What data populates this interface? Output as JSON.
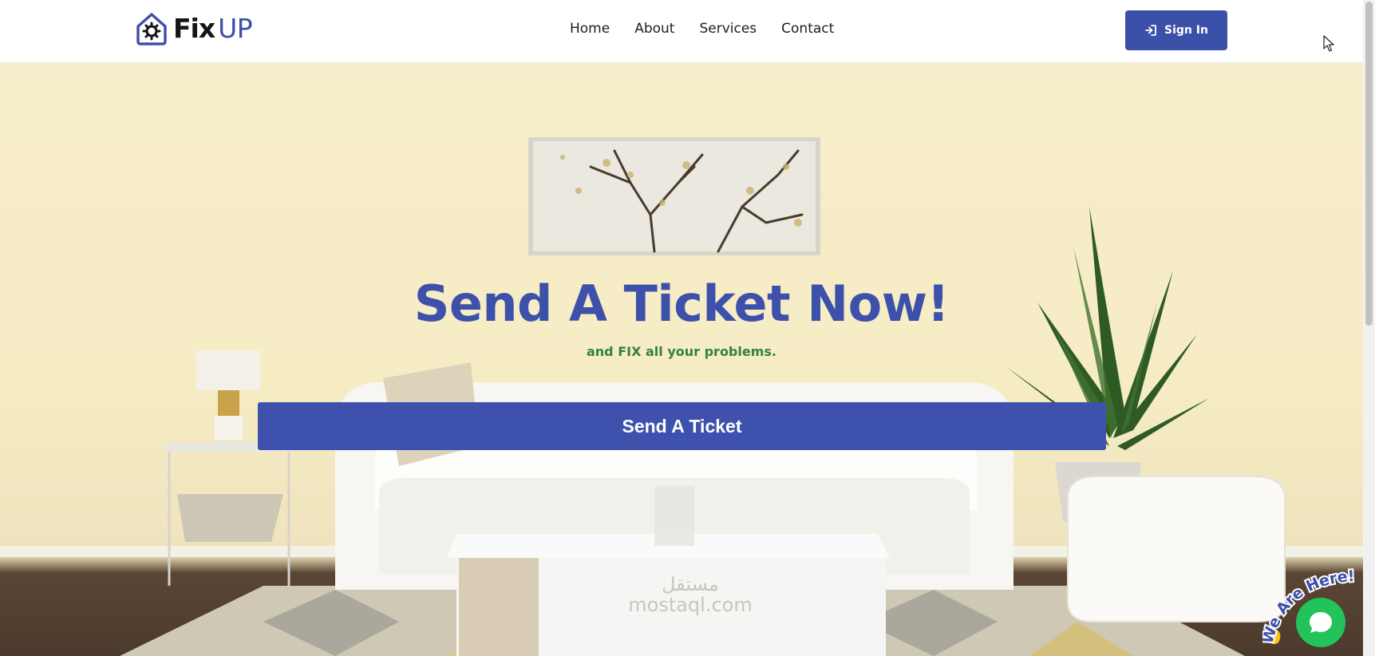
{
  "brand": {
    "name_part1": "Fix",
    "name_part2": "UP",
    "logo_icon": "house-gear-icon"
  },
  "nav": {
    "items": [
      {
        "label": "Home"
      },
      {
        "label": "About"
      },
      {
        "label": "Services"
      },
      {
        "label": "Contact"
      }
    ]
  },
  "header": {
    "signin_label": "Sign In",
    "signin_icon": "sign-in-arrow-icon"
  },
  "hero": {
    "title": "Send A Ticket Now!",
    "subtitle": "and FIX all your problems.",
    "cta_label": "Send A Ticket"
  },
  "watermark": {
    "line1": "مستقل",
    "line2": "mostaql.com"
  },
  "chat": {
    "badge_text": "We Are Here!",
    "icon": "chat-bubble-icon"
  },
  "colors": {
    "primary": "#3e52ad",
    "subtitle_green": "#36813c",
    "chat_green": "#22c35a",
    "wall": "#f6ecc4"
  }
}
